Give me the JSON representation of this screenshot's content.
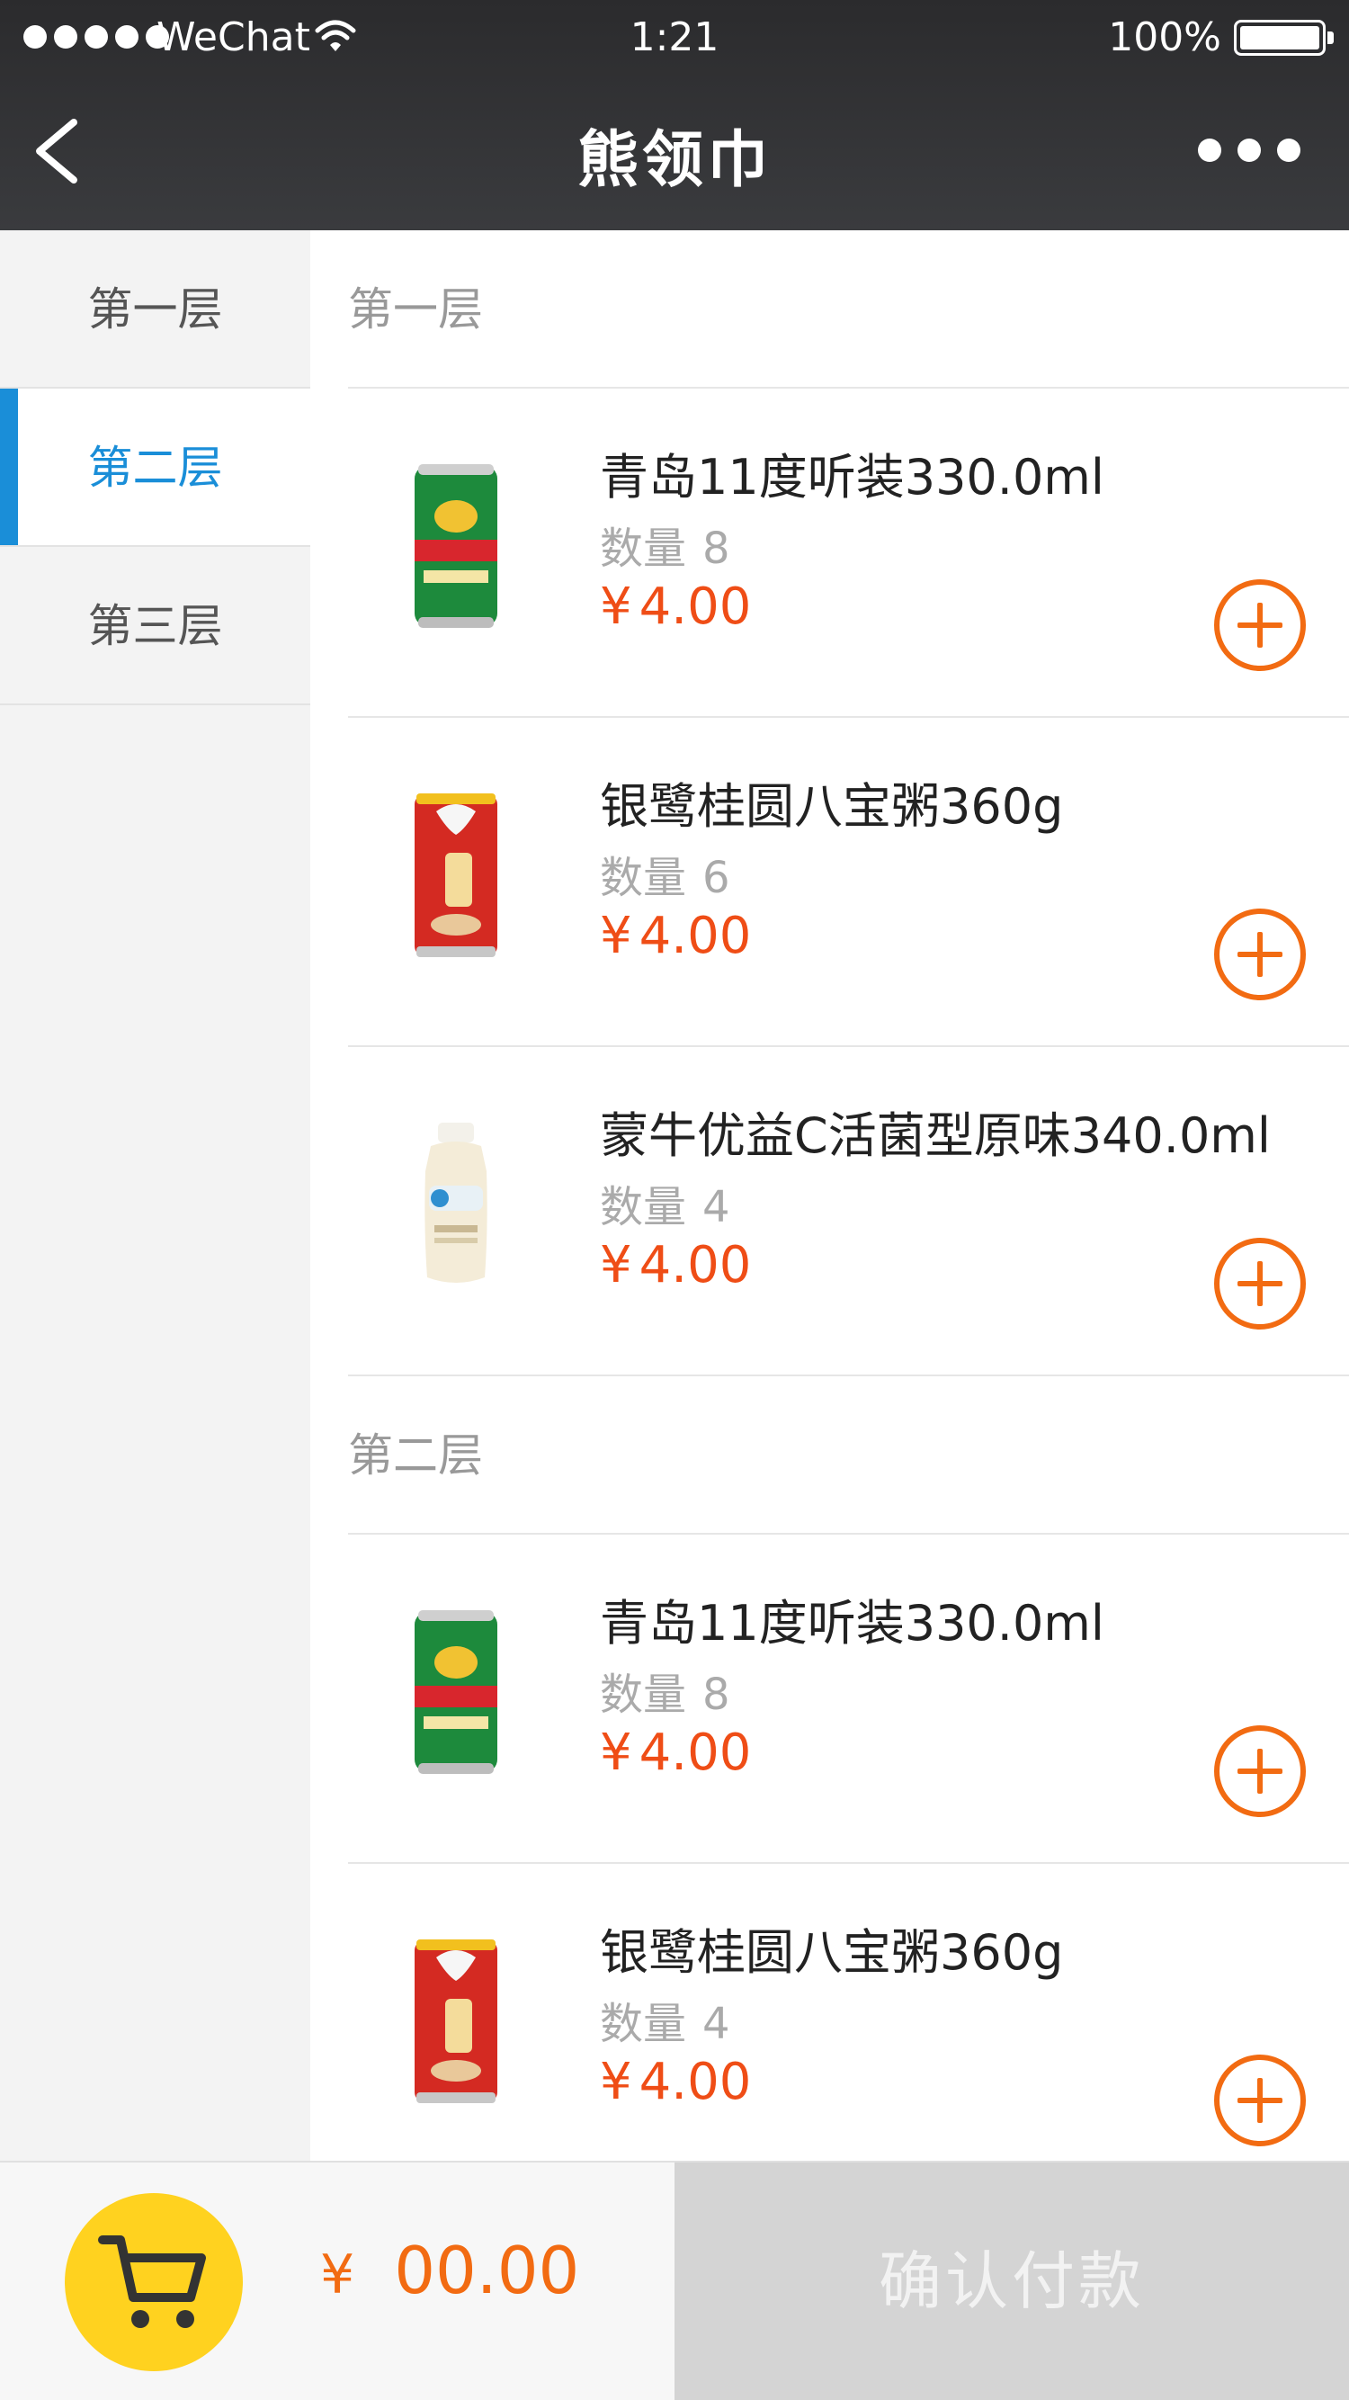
{
  "status_bar": {
    "carrier": "WeChat",
    "time": "1:21",
    "battery": "100%"
  },
  "navbar": {
    "title": "熊领巾"
  },
  "sidebar": {
    "items": [
      {
        "label": "第一层",
        "active": false
      },
      {
        "label": "第二层",
        "active": true
      },
      {
        "label": "第三层",
        "active": false
      }
    ]
  },
  "sections": [
    {
      "title": "第一层",
      "items": [
        {
          "name": "青岛11度听装330.0ml",
          "qty_label": "数量",
          "qty": "8",
          "currency": "¥",
          "price": "4.00",
          "image": "tsingtao-can"
        },
        {
          "name": "银鹭桂圆八宝粥360g",
          "qty_label": "数量",
          "qty": "6",
          "currency": "¥",
          "price": "4.00",
          "image": "yinlu-porridge-can"
        },
        {
          "name": "蒙牛优益C活菌型原味340.0ml",
          "qty_label": "数量",
          "qty": "4",
          "currency": "¥",
          "price": "4.00",
          "image": "mengniu-yogurt-bottle"
        }
      ]
    },
    {
      "title": "第二层",
      "items": [
        {
          "name": "青岛11度听装330.0ml",
          "qty_label": "数量",
          "qty": "8",
          "currency": "¥",
          "price": "4.00",
          "image": "tsingtao-can"
        },
        {
          "name": "银鹭桂圆八宝粥360g",
          "qty_label": "数量",
          "qty": "4",
          "currency": "¥",
          "price": "4.00",
          "image": "yinlu-porridge-can"
        }
      ]
    }
  ],
  "bottom_bar": {
    "currency": "¥",
    "total": "00.00",
    "confirm_label": "确认付款"
  },
  "colors": {
    "accent_blue": "#1a8ed8",
    "price_orange": "#ef4d16",
    "cart_yellow": "#ffd21f",
    "confirm_gray": "#d4d4d4"
  }
}
